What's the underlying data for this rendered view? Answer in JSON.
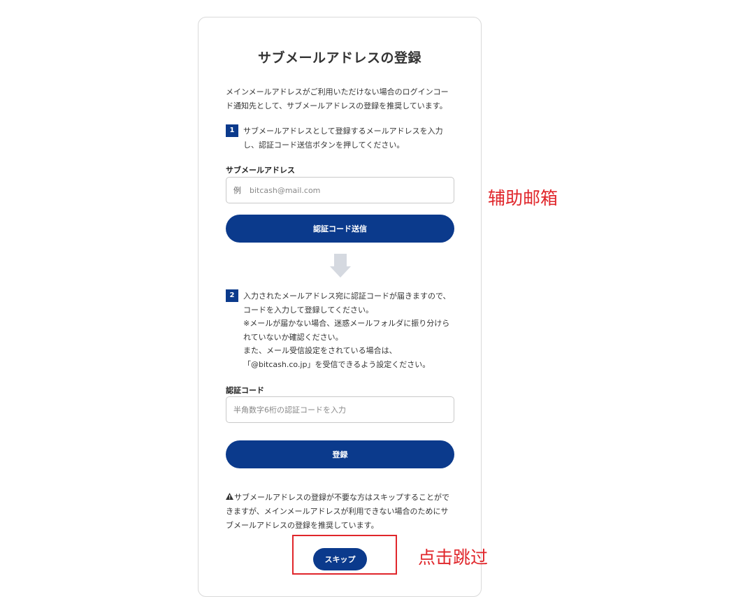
{
  "page": {
    "title": "サブメールアドレスの登録",
    "intro": [
      "メインメールアドレスがご利用いただけない場合のログインコー",
      "ド通知先として、サブメールアドレスの登録を推奨しています。"
    ]
  },
  "step1": {
    "number": "1",
    "lines": [
      "サブメールアドレスとして登録するメールアドレスを入力",
      "し、認証コード送信ボタンを押してください。"
    ]
  },
  "email_field": {
    "label": "サブメールアドレス",
    "prefix": "例",
    "placeholder": "bitcash@mail.com"
  },
  "send_code_button": {
    "label": "認証コード送信"
  },
  "step2": {
    "number": "2",
    "lines": [
      "入力されたメールアドレス宛に認証コードが届きますので、",
      "コードを入力して登録してください。",
      "※メールが届かない場合、迷惑メールフォルダに振り分けら",
      "れていないか確認ください。",
      "また、メール受信設定をされている場合は、",
      "「@bitcash.co.jp」を受信できるよう設定ください。"
    ]
  },
  "code_field": {
    "label": "認証コード",
    "placeholder": "半角数字6桁の認証コードを入力"
  },
  "register_button": {
    "label": "登録"
  },
  "notice": {
    "icon": "warning-icon",
    "lines": [
      "サブメールアドレスの登録が不要な方はスキップすることがで",
      "きますが、メインメールアドレスが利用できない場合のためにサ",
      "ブメールアドレスの登録を推奨しています。"
    ]
  },
  "skip_button": {
    "label": "スキップ"
  },
  "annotations": {
    "email_note": "辅助邮箱",
    "skip_note": "点击跳过"
  },
  "colors": {
    "primary": "#0b3a8c",
    "annotation": "#e0262b"
  }
}
